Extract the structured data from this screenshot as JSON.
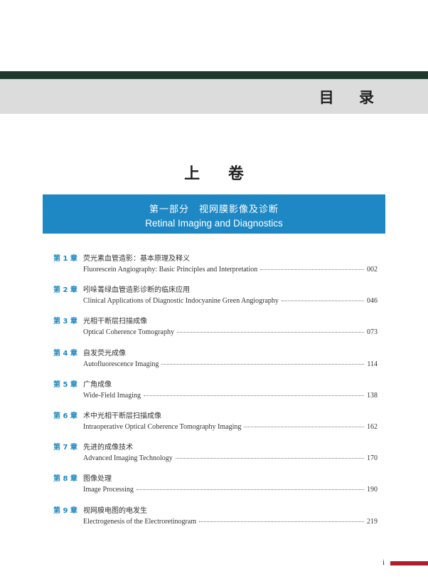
{
  "header": {
    "title": "目 录"
  },
  "volume": {
    "title": "上 卷"
  },
  "part": {
    "title_cn": "第一部分　视网膜影像及诊断",
    "title_en": "Retinal Imaging and Diagnostics"
  },
  "toc": [
    {
      "num": "第 1 章",
      "cn": "荧光素血管造影：基本原理及释义",
      "en": "Fluorescein Angiography: Basic Principles and Interpretation",
      "page": "002"
    },
    {
      "num": "第 2 章",
      "cn": "吲哚菁绿血管造影诊断的临床应用",
      "en": "Clinical Applications of Diagnostic Indocyanine Green Angiography",
      "page": "046"
    },
    {
      "num": "第 3 章",
      "cn": "光相干断层扫描成像",
      "en": "Optical Coherence Tomography",
      "page": "073"
    },
    {
      "num": "第 4 章",
      "cn": "自发荧光成像",
      "en": "Autofluorescence Imaging",
      "page": "114"
    },
    {
      "num": "第 5 章",
      "cn": "广角成像",
      "en": "Wide-Field Imaging",
      "page": "138"
    },
    {
      "num": "第 6 章",
      "cn": "术中光相干断层扫描成像",
      "en": "Intraoperative Optical Coherence Tomography Imaging",
      "page": "162"
    },
    {
      "num": "第 7 章",
      "cn": "先进的成像技术",
      "en": "Advanced Imaging Technology",
      "page": "170"
    },
    {
      "num": "第 8 章",
      "cn": "图像处理",
      "en": "Image Processing",
      "page": "190"
    },
    {
      "num": "第 9 章",
      "cn": "视网膜电图的电发生",
      "en": "Electrogenesis of the Electroretinogram",
      "page": "219"
    }
  ],
  "footer": {
    "folio": "i"
  },
  "colors": {
    "accent": "#1e88c4",
    "top_bar": "#1f3a2a",
    "band": "#dcdcdc",
    "folio_bar": "#b01d2b"
  }
}
